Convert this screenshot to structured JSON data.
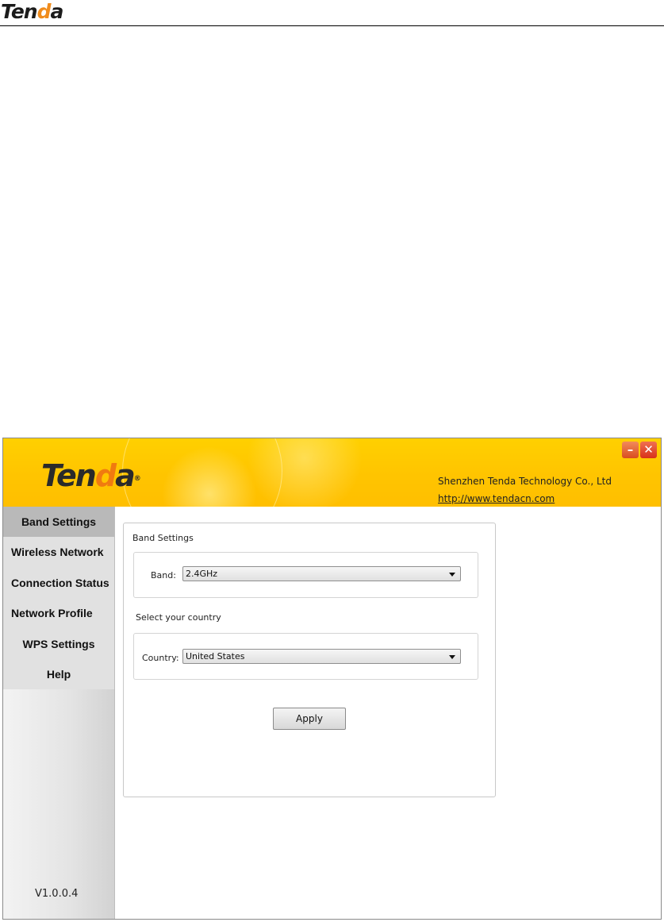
{
  "document": {
    "logo_prefix": "Ten",
    "logo_d": "d",
    "logo_suffix": "a"
  },
  "app": {
    "logo_prefix": "Ten",
    "logo_d": "d",
    "logo_suffix": "a",
    "logo_mark": "®",
    "company": "Shenzhen Tenda Technology Co., Ltd",
    "website": "http://www.tendacn.com",
    "minimize_glyph": "–",
    "close_glyph": "✕",
    "version": "V1.0.0.4"
  },
  "sidebar": {
    "items": [
      {
        "label": "Band Settings",
        "active": true
      },
      {
        "label": "Wireless Network",
        "active": false
      },
      {
        "label": "Connection Status",
        "active": false
      },
      {
        "label": "Network Profile",
        "active": false
      },
      {
        "label": "WPS Settings",
        "active": false
      },
      {
        "label": "Help",
        "active": false
      }
    ]
  },
  "content": {
    "band_section_title": "Band Settings",
    "band_label": "Band:",
    "band_value": "2.4GHz",
    "country_section_title": "Select your country",
    "country_label": "Country:",
    "country_value": "United States",
    "apply_label": "Apply"
  },
  "colors": {
    "banner": "#ffc400",
    "accent_orange": "#f07a10",
    "close_button": "#d8321a"
  }
}
